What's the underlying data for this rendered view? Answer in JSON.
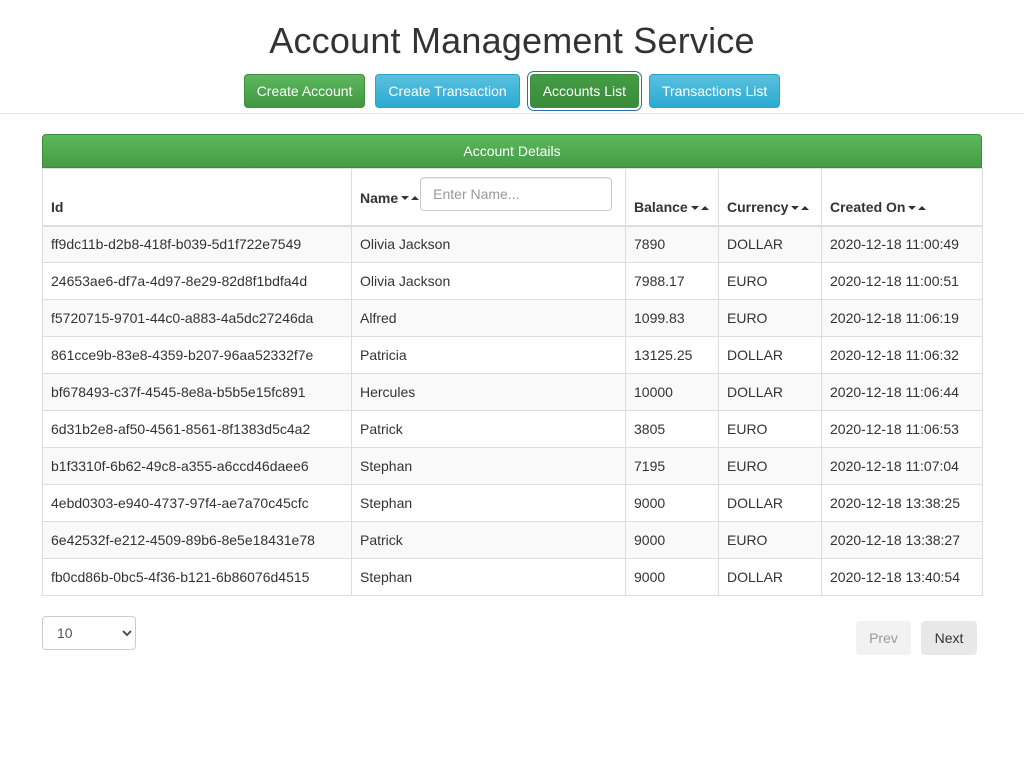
{
  "app": {
    "title": "Account Management Service"
  },
  "nav": {
    "create_account": "Create Account",
    "create_transaction": "Create Transaction",
    "accounts_list": "Accounts List",
    "transactions_list": "Transactions List"
  },
  "panel": {
    "title": "Account Details"
  },
  "table": {
    "headers": {
      "id": "Id",
      "name": "Name",
      "balance": "Balance",
      "currency": "Currency",
      "created_on": "Created On"
    },
    "name_filter_placeholder": "Enter Name...",
    "rows": [
      {
        "id": "ff9dc11b-d2b8-418f-b039-5d1f722e7549",
        "name": "Olivia Jackson",
        "balance": "7890",
        "currency": "DOLLAR",
        "created_on": "2020-12-18 11:00:49"
      },
      {
        "id": "24653ae6-df7a-4d97-8e29-82d8f1bdfa4d",
        "name": "Olivia Jackson",
        "balance": "7988.17",
        "currency": "EURO",
        "created_on": "2020-12-18 11:00:51"
      },
      {
        "id": "f5720715-9701-44c0-a883-4a5dc27246da",
        "name": "Alfred",
        "balance": "1099.83",
        "currency": "EURO",
        "created_on": "2020-12-18 11:06:19"
      },
      {
        "id": "861cce9b-83e8-4359-b207-96aa52332f7e",
        "name": "Patricia",
        "balance": "13125.25",
        "currency": "DOLLAR",
        "created_on": "2020-12-18 11:06:32"
      },
      {
        "id": "bf678493-c37f-4545-8e8a-b5b5e15fc891",
        "name": "Hercules",
        "balance": "10000",
        "currency": "DOLLAR",
        "created_on": "2020-12-18 11:06:44"
      },
      {
        "id": "6d31b2e8-af50-4561-8561-8f1383d5c4a2",
        "name": "Patrick",
        "balance": "3805",
        "currency": "EURO",
        "created_on": "2020-12-18 11:06:53"
      },
      {
        "id": "b1f3310f-6b62-49c8-a355-a6ccd46daee6",
        "name": "Stephan",
        "balance": "7195",
        "currency": "EURO",
        "created_on": "2020-12-18 11:07:04"
      },
      {
        "id": "4ebd0303-e940-4737-97f4-ae7a70c45cfc",
        "name": "Stephan",
        "balance": "9000",
        "currency": "DOLLAR",
        "created_on": "2020-12-18 13:38:25"
      },
      {
        "id": "6e42532f-e212-4509-89b6-8e5e18431e78",
        "name": "Patrick",
        "balance": "9000",
        "currency": "EURO",
        "created_on": "2020-12-18 13:38:27"
      },
      {
        "id": "fb0cd86b-0bc5-4f36-b121-6b86076d4515",
        "name": "Stephan",
        "balance": "9000",
        "currency": "DOLLAR",
        "created_on": "2020-12-18 13:40:54"
      }
    ]
  },
  "pagination": {
    "page_size": "10",
    "page_size_options": [
      "10"
    ],
    "prev": "Prev",
    "next": "Next"
  },
  "colors": {
    "primary_green": "#5cb85c",
    "info_blue": "#5bc0de",
    "stripe": "#f9f9f9"
  }
}
